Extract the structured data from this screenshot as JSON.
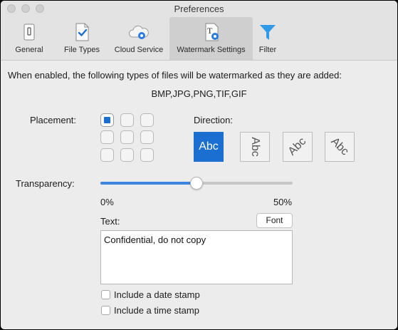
{
  "window": {
    "title": "Preferences"
  },
  "toolbar": {
    "tabs": [
      {
        "label": "General",
        "icon": "general-icon",
        "active": false
      },
      {
        "label": "File Types",
        "icon": "file-types-icon",
        "active": false
      },
      {
        "label": "Cloud Service",
        "icon": "cloud-gear-icon",
        "active": false
      },
      {
        "label": "Watermark Settings",
        "icon": "watermark-icon",
        "active": true
      },
      {
        "label": "Filter",
        "icon": "filter-icon",
        "active": false
      }
    ]
  },
  "main": {
    "description": "When enabled, the following types of files will be watermarked as they are added:",
    "file_types": "BMP,JPG,PNG,TIF,GIF",
    "placement": {
      "label": "Placement:",
      "selected_cell": "top-left"
    },
    "direction": {
      "label": "Direction:",
      "options": [
        {
          "text": "Abc",
          "rotation": "horizontal",
          "selected": true
        },
        {
          "text": "Abc",
          "rotation": "vertical",
          "selected": false
        },
        {
          "text": "Abc",
          "rotation": "diagonal-up",
          "selected": false
        },
        {
          "text": "Abc",
          "rotation": "diagonal-down",
          "selected": false
        }
      ]
    },
    "transparency": {
      "label": "Transparency:",
      "min_label": "0%",
      "max_label": "50%",
      "value_fraction": 0.5
    },
    "text": {
      "label": "Text:",
      "font_button": "Font",
      "value": "Confidential, do not copy"
    },
    "checkboxes": [
      {
        "label": "Include a date stamp",
        "checked": false
      },
      {
        "label": "Include a time stamp",
        "checked": false
      }
    ]
  },
  "colors": {
    "accent": "#1a6fd0",
    "slider_fill": "#3b85e0",
    "filter_icon": "#2f9be8"
  }
}
